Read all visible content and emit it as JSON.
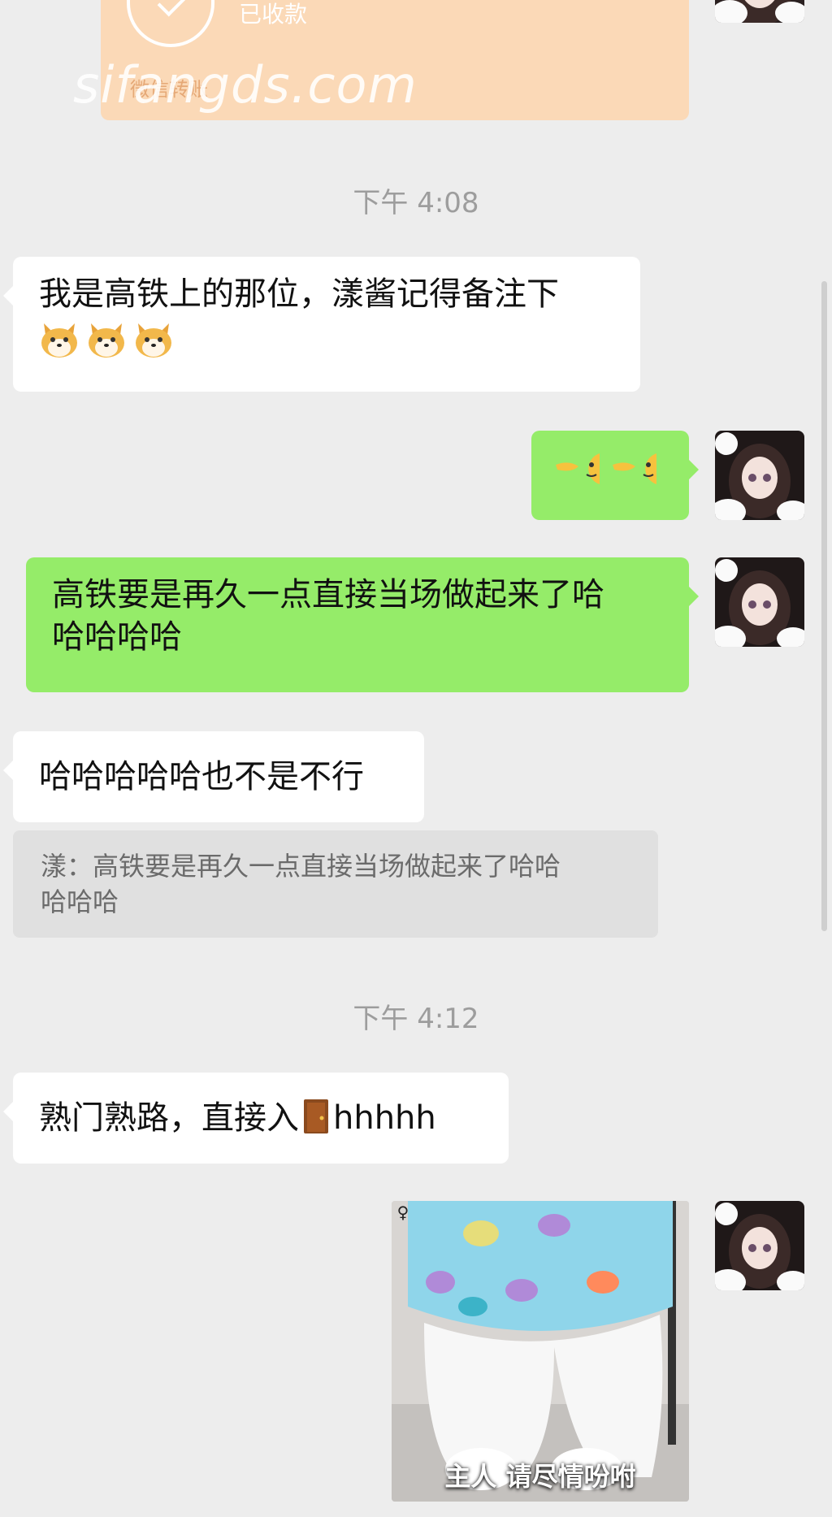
{
  "transfer": {
    "status": "已收款",
    "footer": "微信转账"
  },
  "watermark": "sifangds.com",
  "messages": {
    "time1": "下午 4:08",
    "msg1_text": "我是高铁上的那位，漾酱记得备注下",
    "msg1_emojis": [
      "dog-emoji",
      "dog-emoji",
      "dog-emoji"
    ],
    "msg2_emojis": [
      "peek-emoji",
      "peek-emoji"
    ],
    "msg3_line1": "高铁要是再久一点直接当场做起来了哈",
    "msg3_line2": "哈哈哈哈",
    "msg4_text": "哈哈哈哈哈也不是不行",
    "quote_line1": "漾：高铁要是再久一点直接当场做起来了哈哈",
    "quote_line2": "哈哈哈",
    "time2": "下午 4:12",
    "msg5_before": "熟门熟路，直接入",
    "msg5_after": "hhhhh",
    "photo_caption": "主人 请尽情吩咐"
  },
  "colors": {
    "background": "#ededed",
    "incoming_bubble": "#ffffff",
    "outgoing_bubble": "#95ec69",
    "transfer_card": "#fbd9b7",
    "quote_bg": "#e0e0e0"
  }
}
